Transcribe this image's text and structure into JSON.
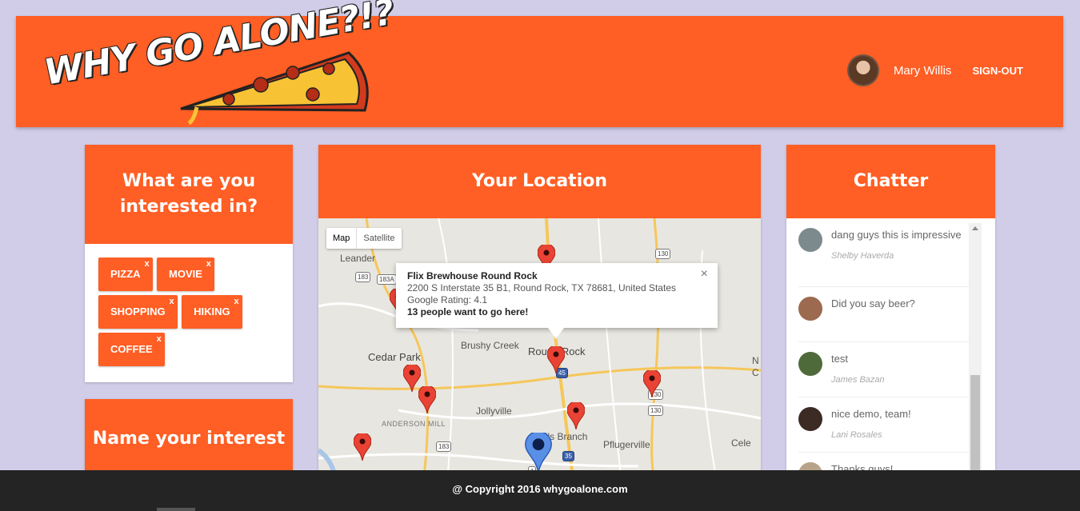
{
  "header": {
    "logo_text": "WHY GO ALONE?!?",
    "user_name": "Mary Willis",
    "signout_label": "SIGN-OUT"
  },
  "interests": {
    "title": "What are you interested in?",
    "tags": [
      "PIZZA",
      "MOVIE",
      "SHOPPING",
      "HIKING",
      "COFFEE"
    ],
    "remove_glyph": "x"
  },
  "name_interest": {
    "title": "Name your interest"
  },
  "location": {
    "title": "Your Location",
    "map_toggle": [
      "Map",
      "Satellite"
    ],
    "places": [
      "Leander",
      "Cedar Park",
      "Brushy Creek",
      "Round Rock",
      "Jollyville",
      "Wells Branch",
      "Pflugerville",
      "Cele",
      "ANDERSON MILL",
      "N",
      "C"
    ],
    "highways": [
      "183",
      "183A",
      "130",
      "130",
      "130",
      "45",
      "35",
      "183",
      "1"
    ],
    "infowindow": {
      "name": "Flix Brewhouse Round Rock",
      "address": "2200 S Interstate 35 B1, Round Rock, TX 78681, United States",
      "rating": "Google Rating: 4.1",
      "people": "13 people want to go here!",
      "close_glyph": "×"
    }
  },
  "chatter": {
    "title": "Chatter",
    "messages": [
      {
        "text": "dang guys this is impressive",
        "author": "Shelby Haverda",
        "avatar_color": "#7c8a8e"
      },
      {
        "text": "Did you say beer?",
        "author": "",
        "avatar_color": "#9b6a4f"
      },
      {
        "text": "test",
        "author": "James Bazan",
        "avatar_color": "#4f6a3a"
      },
      {
        "text": "nice demo, team!",
        "author": "Lani Rosales",
        "avatar_color": "#3c2a24"
      },
      {
        "text": "Thanks guys!",
        "author": "",
        "avatar_color": "#b8a38a"
      }
    ]
  },
  "footer": {
    "copyright": "@ Copyright 2016 whygoalone.com"
  },
  "colors": {
    "accent": "#ff5e24",
    "background": "#d1cde9",
    "footer": "#242424"
  }
}
